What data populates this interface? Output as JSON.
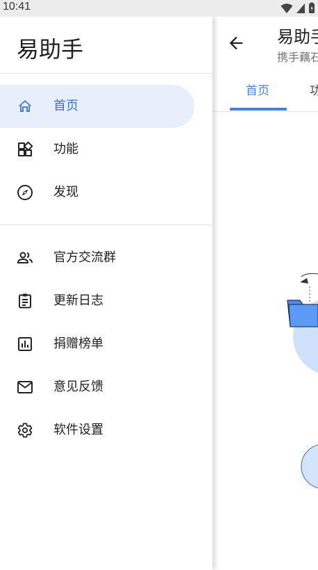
{
  "status_bar": {
    "time": "10:41"
  },
  "drawer": {
    "title": "易助手",
    "primary_items": [
      {
        "label": "首页",
        "icon": "home-icon",
        "active": true
      },
      {
        "label": "功能",
        "icon": "widgets-icon",
        "active": false
      },
      {
        "label": "发现",
        "icon": "compass-icon",
        "active": false
      }
    ],
    "secondary_items": [
      {
        "label": "官方交流群",
        "icon": "people-icon"
      },
      {
        "label": "更新日志",
        "icon": "clipboard-icon"
      },
      {
        "label": "捐赠榜单",
        "icon": "chart-icon"
      },
      {
        "label": "意见反馈",
        "icon": "mail-icon"
      },
      {
        "label": "软件设置",
        "icon": "settings-gear-icon"
      }
    ]
  },
  "main": {
    "title": "易助手",
    "subtitle": "携手藕石",
    "tabs": [
      {
        "label": "首页",
        "active": true
      },
      {
        "label": "功能",
        "active": false
      }
    ]
  },
  "colors": {
    "accent": "#4a7fd6",
    "active_bg": "#e7effd",
    "illustration_blue": "#6aa8f2"
  }
}
